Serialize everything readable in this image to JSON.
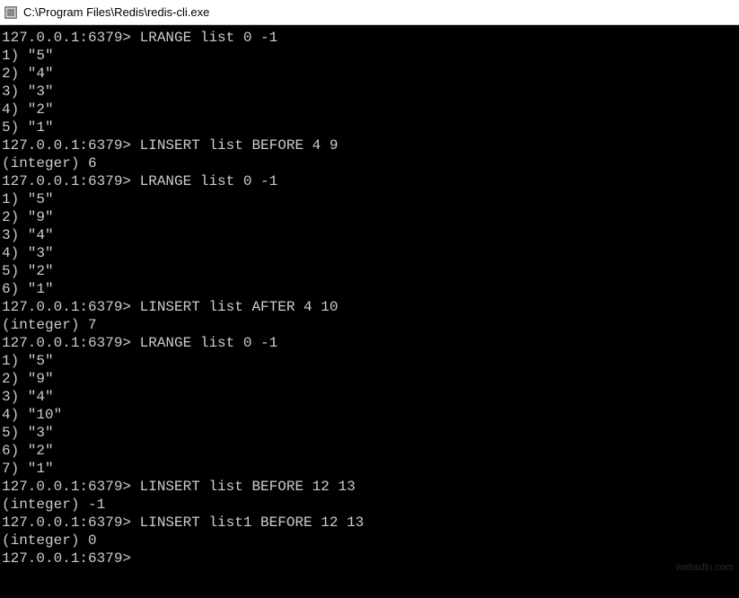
{
  "window": {
    "title": "C:\\Program Files\\Redis\\redis-cli.exe"
  },
  "prompt": "127.0.0.1:6379>",
  "lines": [
    {
      "type": "cmd",
      "text": "LRANGE list 0 -1"
    },
    {
      "type": "out",
      "text": "1) \"5\""
    },
    {
      "type": "out",
      "text": "2) \"4\""
    },
    {
      "type": "out",
      "text": "3) \"3\""
    },
    {
      "type": "out",
      "text": "4) \"2\""
    },
    {
      "type": "out",
      "text": "5) \"1\""
    },
    {
      "type": "cmd",
      "text": "LINSERT list BEFORE 4 9"
    },
    {
      "type": "out",
      "text": "(integer) 6"
    },
    {
      "type": "cmd",
      "text": "LRANGE list 0 -1"
    },
    {
      "type": "out",
      "text": "1) \"5\""
    },
    {
      "type": "out",
      "text": "2) \"9\""
    },
    {
      "type": "out",
      "text": "3) \"4\""
    },
    {
      "type": "out",
      "text": "4) \"3\""
    },
    {
      "type": "out",
      "text": "5) \"2\""
    },
    {
      "type": "out",
      "text": "6) \"1\""
    },
    {
      "type": "cmd",
      "text": "LINSERT list AFTER 4 10"
    },
    {
      "type": "out",
      "text": "(integer) 7"
    },
    {
      "type": "cmd",
      "text": "LRANGE list 0 -1"
    },
    {
      "type": "out",
      "text": "1) \"5\""
    },
    {
      "type": "out",
      "text": "2) \"9\""
    },
    {
      "type": "out",
      "text": "3) \"4\""
    },
    {
      "type": "out",
      "text": "4) \"10\""
    },
    {
      "type": "out",
      "text": "5) \"3\""
    },
    {
      "type": "out",
      "text": "6) \"2\""
    },
    {
      "type": "out",
      "text": "7) \"1\""
    },
    {
      "type": "cmd",
      "text": "LINSERT list BEFORE 12 13"
    },
    {
      "type": "out",
      "text": "(integer) -1"
    },
    {
      "type": "cmd",
      "text": "LINSERT list1 BEFORE 12 13"
    },
    {
      "type": "out",
      "text": "(integer) 0"
    },
    {
      "type": "cmd",
      "text": ""
    }
  ],
  "watermark": "websdln.com"
}
